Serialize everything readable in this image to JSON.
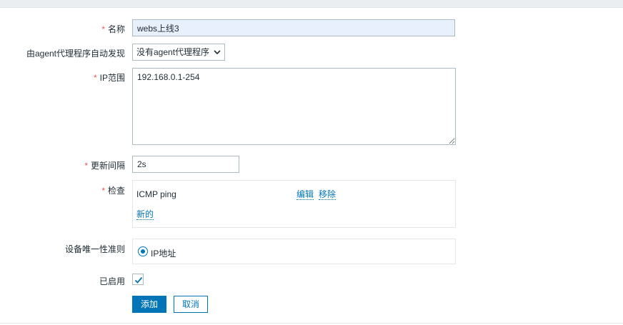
{
  "form": {
    "required_mark": "*",
    "name": {
      "label": "名称",
      "value": "webs上线3"
    },
    "proxy": {
      "label": "由agent代理程序自动发现",
      "selected": "没有agent代理程序"
    },
    "ip_range": {
      "label": "IP范围",
      "value": "192.168.0.1-254"
    },
    "update_interval": {
      "label": "更新间隔",
      "value": "2s"
    },
    "checks": {
      "label": "检查",
      "items": [
        {
          "name": "ICMP ping",
          "edit_label": "编辑",
          "remove_label": "移除"
        }
      ],
      "new_label": "新的"
    },
    "uniqueness": {
      "label": "设备唯一性准则",
      "option": "IP地址",
      "selected": true
    },
    "enabled": {
      "label": "已启用",
      "checked": true
    },
    "buttons": {
      "add": "添加",
      "cancel": "取消"
    }
  },
  "colors": {
    "accent": "#0275b8",
    "required": "#e45959",
    "autofill_bg": "#e8f0fe"
  }
}
